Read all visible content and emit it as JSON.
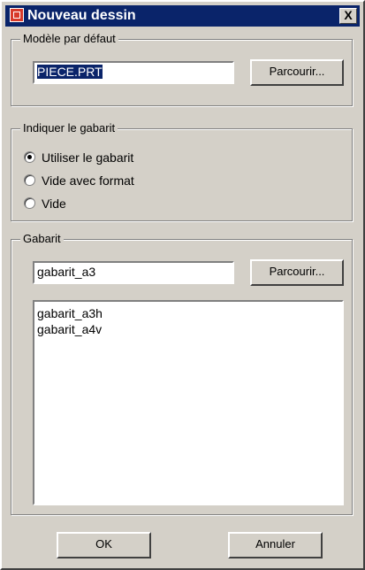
{
  "window": {
    "title": "Nouveau dessin",
    "close_glyph": "X"
  },
  "default_model": {
    "group_label": "Modèle par défaut",
    "value": "PIECE.PRT",
    "browse_label": "Parcourir..."
  },
  "template_option": {
    "group_label": "Indiquer le gabarit",
    "options": [
      {
        "label": "Utiliser le gabarit",
        "selected": true
      },
      {
        "label": "Vide avec format",
        "selected": false
      },
      {
        "label": "Vide",
        "selected": false
      }
    ]
  },
  "template": {
    "group_label": "Gabarit",
    "value": "gabarit_a3",
    "browse_label": "Parcourir...",
    "list_items": [
      "gabarit_a3h",
      "gabarit_a4v"
    ]
  },
  "actions": {
    "ok_label": "OK",
    "cancel_label": "Annuler"
  },
  "colors": {
    "titlebar": "#0a246a",
    "dialog_face": "#d4d0c8"
  }
}
